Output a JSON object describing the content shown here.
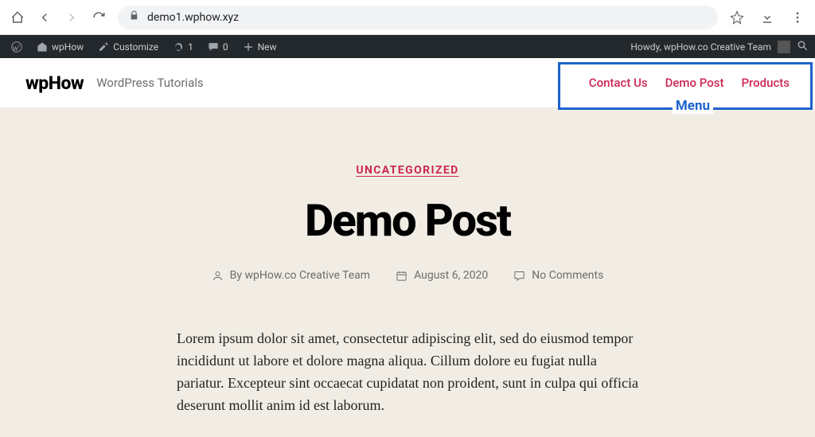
{
  "browser": {
    "url": "demo1.wphow.xyz"
  },
  "wp_bar": {
    "site_name": "wpHow",
    "customize": "Customize",
    "updates": "1",
    "comments": "0",
    "new": "New",
    "howdy": "Howdy, wpHow.co Creative Team"
  },
  "header": {
    "title": "wpHow",
    "tagline": "WordPress Tutorials",
    "nav": {
      "contact": "Contact Us",
      "demo": "Demo Post",
      "products": "Products"
    },
    "menu_label": "Menu"
  },
  "post": {
    "category": "UNCATEGORIZED",
    "title": "Demo Post",
    "author_prefix": "By",
    "author": "wpHow.co Creative Team",
    "date": "August 6, 2020",
    "comments": "No Comments",
    "body": "Lorem ipsum dolor sit amet, consectetur adipiscing elit, sed do eiusmod tempor incididunt ut labore et dolore magna aliqua. Cillum dolore eu fugiat nulla pariatur. Excepteur sint occaecat cupidatat non proident, sunt in culpa qui officia deserunt mollit anim id est laborum."
  }
}
